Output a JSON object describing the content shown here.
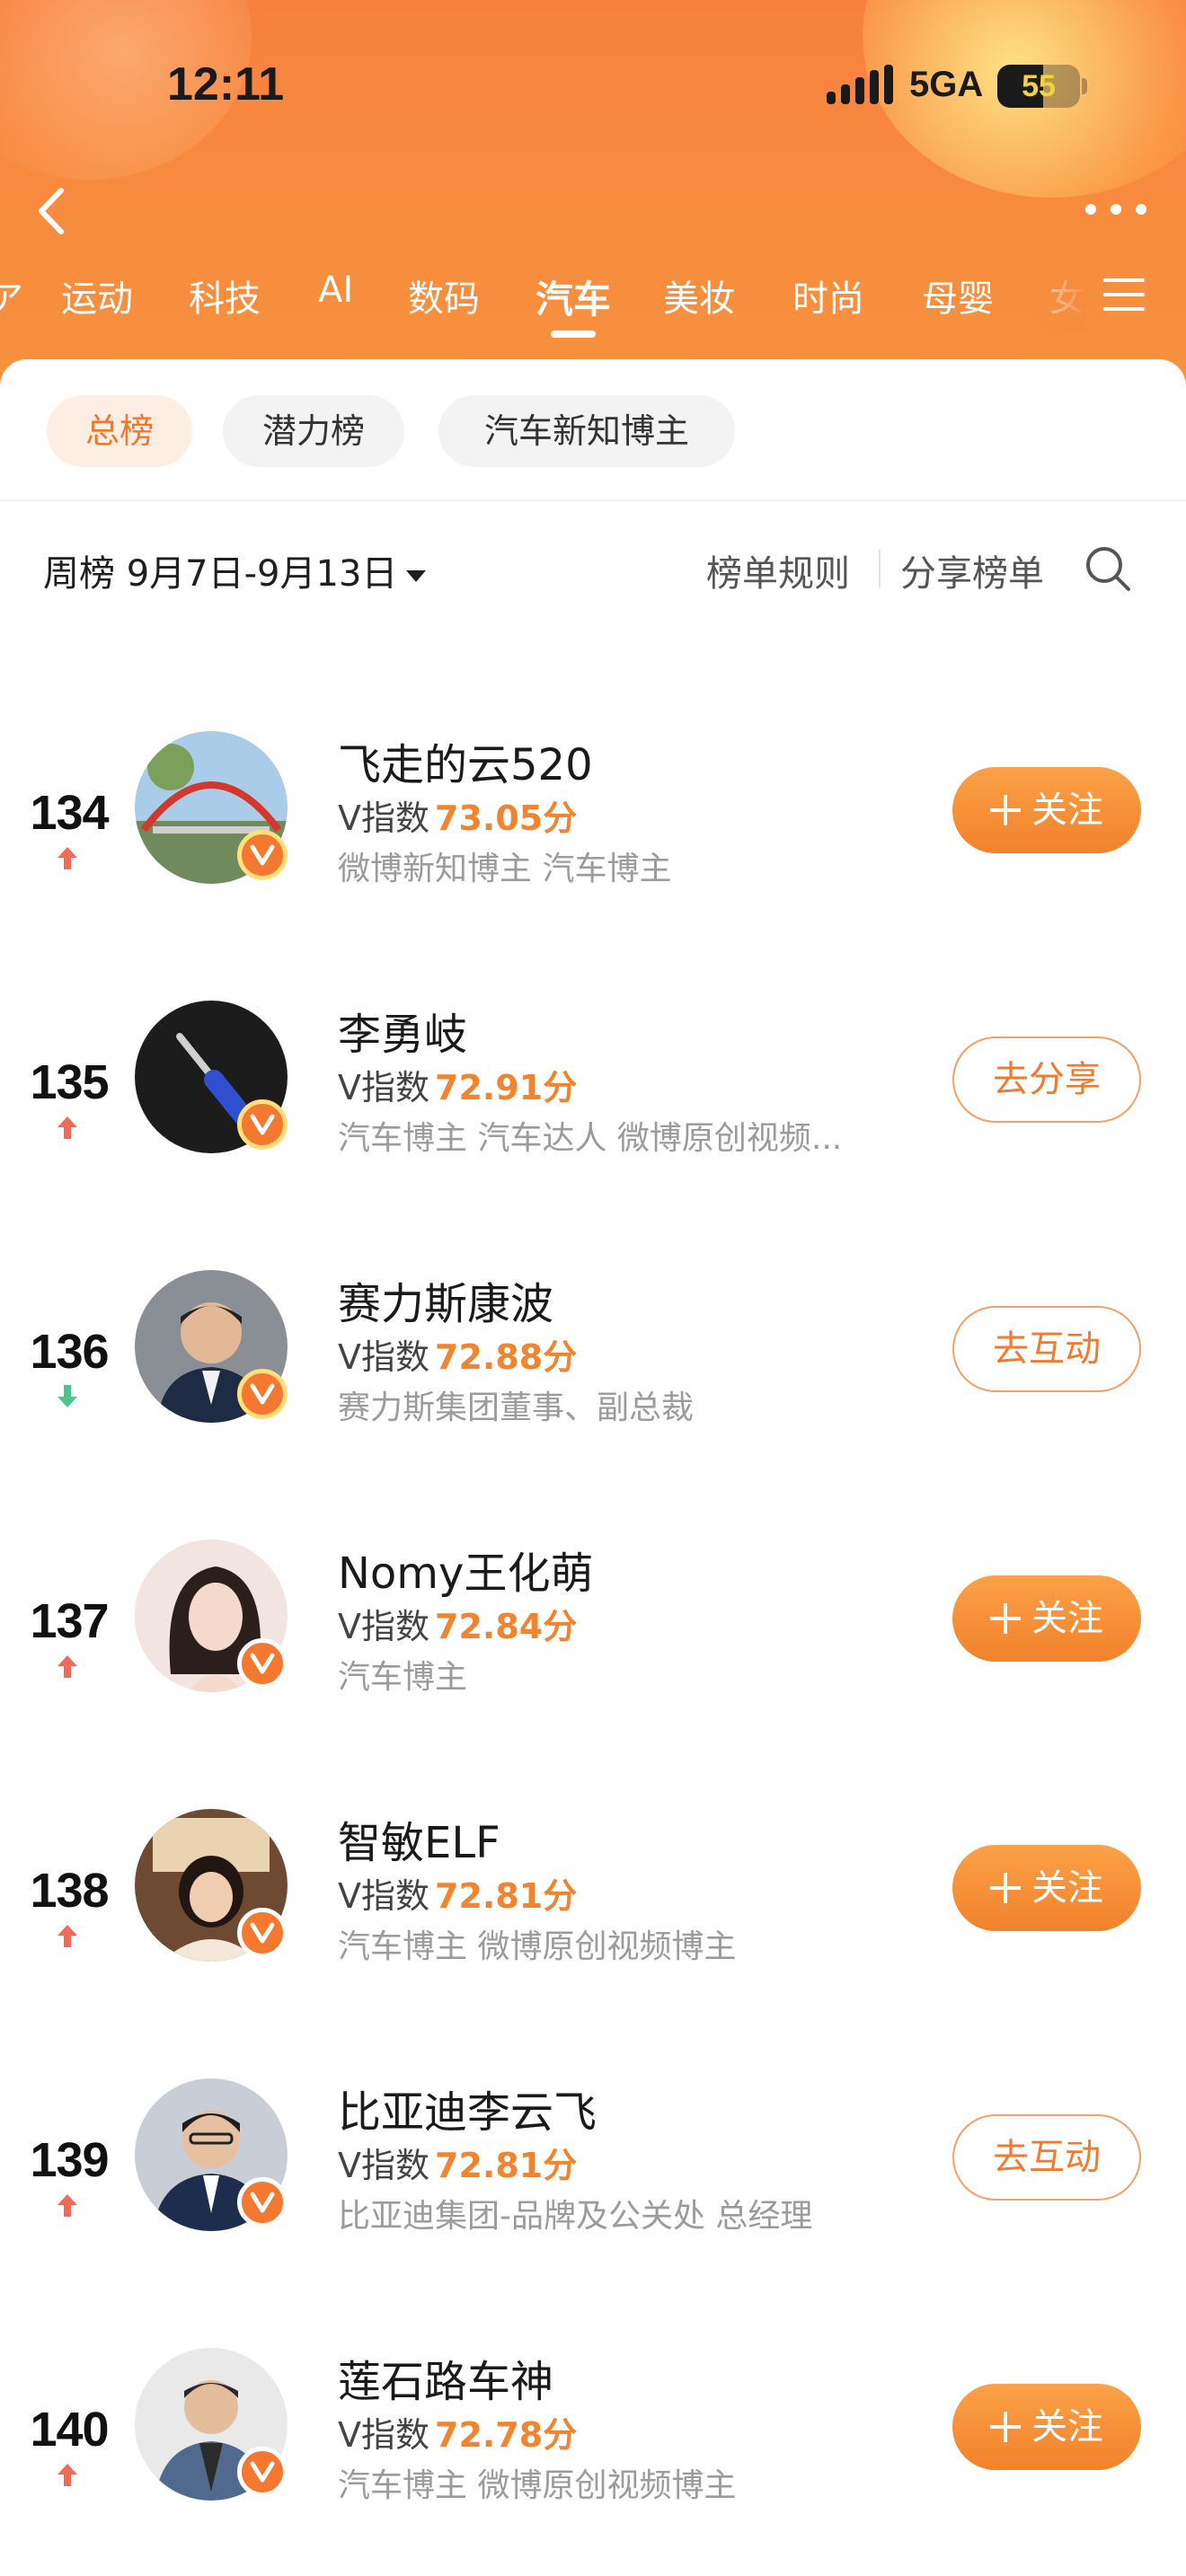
{
  "status_bar": {
    "time": "12:11",
    "network": "5GA",
    "battery": "55",
    "battery_fraction": 0.55
  },
  "tabs": [
    {
      "label": "运动",
      "active": false
    },
    {
      "label": "科技",
      "active": false
    },
    {
      "label": "AI",
      "active": false
    },
    {
      "label": "数码",
      "active": false
    },
    {
      "label": "汽车",
      "active": true
    },
    {
      "label": "美妆",
      "active": false
    },
    {
      "label": "时尚",
      "active": false
    },
    {
      "label": "母婴",
      "active": false
    }
  ],
  "chips": [
    {
      "label": "总榜",
      "active": true
    },
    {
      "label": "潜力榜",
      "active": false
    },
    {
      "label": "汽车新知博主",
      "active": false
    }
  ],
  "toolbar": {
    "period": "周榜 9月7日-9月13日",
    "rules": "榜单规则",
    "share": "分享榜单"
  },
  "ranking": {
    "v_label": "V指数",
    "rows": [
      {
        "rank": "134",
        "trend": "up",
        "name": "飞走的云520",
        "score": "73.05分",
        "tags": "微博新知博主 汽车博主",
        "action": "十关注",
        "action_label": "关注",
        "action_style": "solid",
        "badge": "gold"
      },
      {
        "rank": "135",
        "trend": "up",
        "name": "李勇岐",
        "score": "72.91分",
        "tags": "汽车博主 汽车达人 微博原创视频...",
        "action": "去分享",
        "action_label": "去分享",
        "action_style": "outline",
        "badge": "gold"
      },
      {
        "rank": "136",
        "trend": "down",
        "name": "赛力斯康波",
        "score": "72.88分",
        "tags": "赛力斯集团董事、副总裁",
        "action": "去互动",
        "action_label": "去互动",
        "action_style": "outline",
        "badge": "gold"
      },
      {
        "rank": "137",
        "trend": "up",
        "name": "Nomy王化萌",
        "score": "72.84分",
        "tags": "汽车博主",
        "action": "十关注",
        "action_label": "关注",
        "action_style": "solid",
        "badge": "white"
      },
      {
        "rank": "138",
        "trend": "up",
        "name": "智敏ELF",
        "score": "72.81分",
        "tags": "汽车博主 微博原创视频博主",
        "action": "十关注",
        "action_label": "关注",
        "action_style": "solid",
        "badge": "white"
      },
      {
        "rank": "139",
        "trend": "up",
        "name": "比亚迪李云飞",
        "score": "72.81分",
        "tags": "比亚迪集团-品牌及公关处 总经理",
        "action": "去互动",
        "action_label": "去互动",
        "action_style": "outline",
        "badge": "white"
      },
      {
        "rank": "140",
        "trend": "up",
        "name": "莲石路车神",
        "score": "72.78分",
        "tags": "汽车博主 微博原创视频博主",
        "action": "十关注",
        "action_label": "关注",
        "action_style": "solid",
        "badge": "white"
      }
    ]
  },
  "colors": {
    "accent": "#f0782d",
    "score": "#f0842f",
    "trend_up": "#f06a5a",
    "trend_down": "#4cc58a"
  },
  "icons": {
    "back": "chevron-left-icon",
    "more": "more-dots-icon",
    "menu": "hamburger-menu-icon",
    "search": "search-icon",
    "trend_up": "arrow-up-icon",
    "trend_down": "arrow-down-icon",
    "verified": "verified-v-badge-icon"
  }
}
